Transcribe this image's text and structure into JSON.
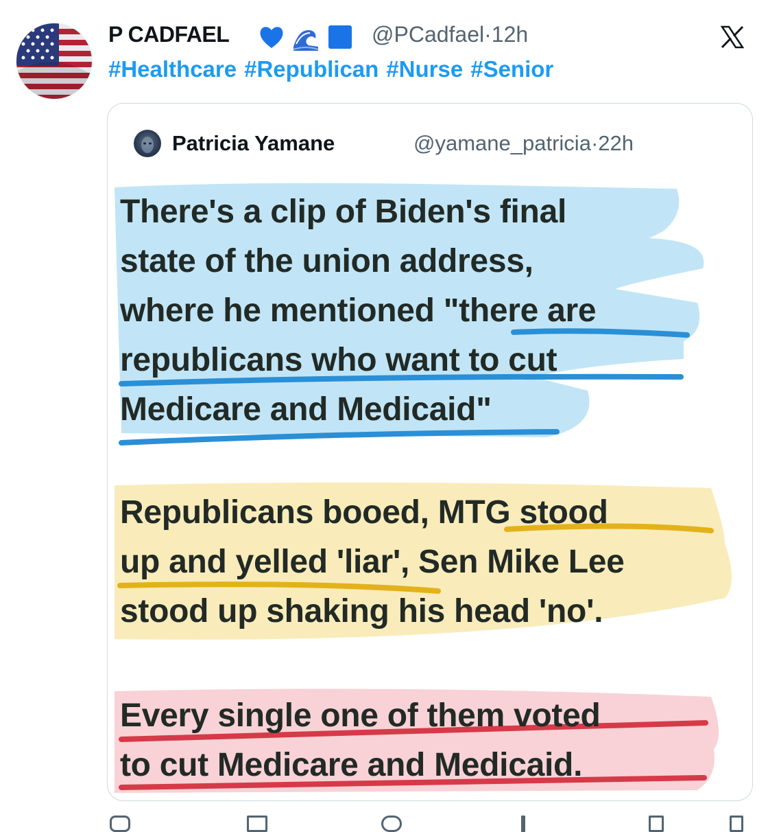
{
  "post": {
    "display_name": "P CADFAEL",
    "emojis": [
      "blue-heart",
      "water-wave",
      "blue-square"
    ],
    "handle": "@PCadfael",
    "separator": "·",
    "time": "12h",
    "hashtags": [
      "#Healthcare",
      "#Republican",
      "#Nurse",
      "#Senior"
    ]
  },
  "quoted": {
    "display_name": "Patricia Yamane",
    "handle": "@yamane_patricia",
    "separator": "·",
    "time": "22h",
    "paragraphs": [
      {
        "highlight_color": "#a9dcf2",
        "lines": [
          "There's a clip of Biden's final",
          "state of the union address,",
          "where he mentioned \"there are",
          "republicans who want to cut",
          "Medicare and Medicaid\""
        ]
      },
      {
        "highlight_color": "#f7e6a6",
        "lines": [
          "Republicans booed, MTG stood",
          "up and yelled 'liar', Sen Mike Lee",
          "stood up shaking his head 'no'."
        ]
      },
      {
        "highlight_color": "#f5c2c7",
        "lines": [
          "Every single one of them voted",
          "to cut Medicare and Medicaid."
        ]
      }
    ],
    "underline_colors": {
      "blue": "#2a8fd6",
      "yellow": "#e3b21a",
      "red": "#d63a48"
    }
  },
  "icons": [
    "flag-avatar-icon",
    "x-logo-icon",
    "reply-icon",
    "repost-icon",
    "like-icon",
    "views-icon",
    "share-icon"
  ]
}
